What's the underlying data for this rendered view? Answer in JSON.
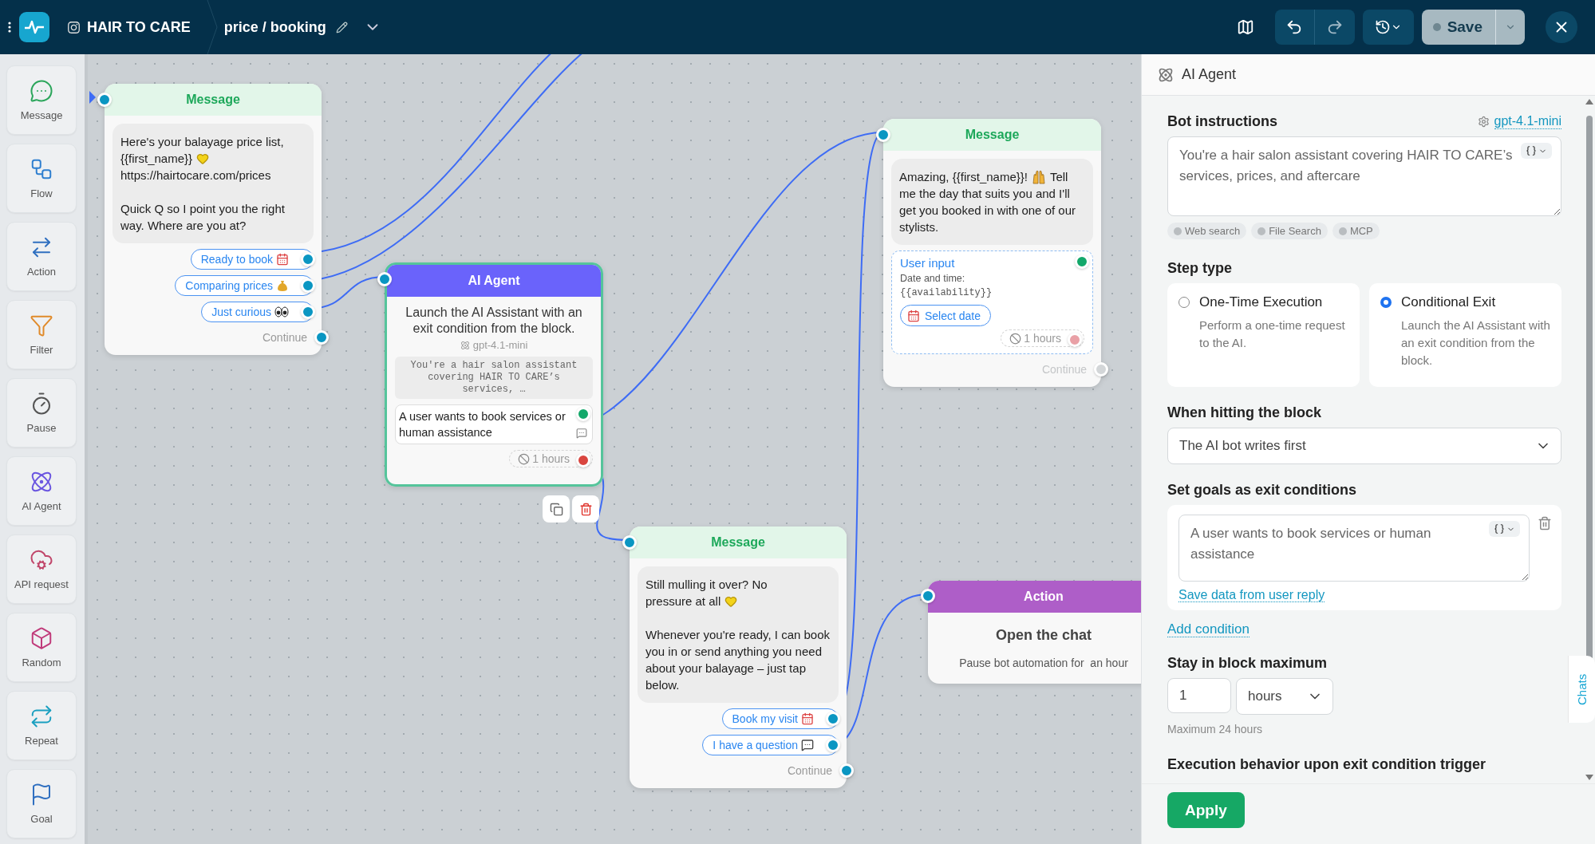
{
  "topbar": {
    "account": "HAIR TO CARE",
    "flow_name": "price / booking",
    "save": "Save"
  },
  "sidebar": {
    "items": [
      {
        "label": "Message",
        "kind": "message"
      },
      {
        "label": "Flow",
        "kind": "flow"
      },
      {
        "label": "Action",
        "kind": "action"
      },
      {
        "label": "Filter",
        "kind": "filter"
      },
      {
        "label": "Pause",
        "kind": "pause"
      },
      {
        "label": "AI Agent",
        "kind": "ai"
      },
      {
        "label": "API request",
        "kind": "api"
      },
      {
        "label": "Random",
        "kind": "random"
      },
      {
        "label": "Repeat",
        "kind": "repeat"
      },
      {
        "label": "Goal",
        "kind": "goal"
      }
    ]
  },
  "canvas": {
    "nodes": [
      {
        "kind": "message",
        "title": "Message",
        "paragraphs": [
          [
            [
              "Here's your balayage price list,"
            ],
            [
              "{{first_name}}"
            ],
            [
              "https://hairtocare.com/prices"
            ]
          ],
          [
            [
              "Quick Q so I point you the right way. Where are you at?"
            ]
          ]
        ],
        "buttons": [
          "Ready to book",
          "Comparing prices",
          "Just curious"
        ],
        "continue": {
          "label": "Continue",
          "disabled": false
        }
      },
      {
        "kind": "ai_agent",
        "title": "AI Agent",
        "selected": true,
        "description": "Launch the AI Assistant with an exit condition from the block.",
        "model": "gpt-4.1-mini",
        "prompt": "You're a hair salon assistant covering HAIR TO CARE’s services, …",
        "condition": "A user wants to book services or human assistance",
        "timeout": "1 hours"
      },
      {
        "kind": "message",
        "title": "Message",
        "paragraphs": [
          [
            [
              "Amazing, {{first_name}}!",
              "Tell"
            ],
            [
              "me the day that suits you and I'll get you booked in with one of our stylists."
            ]
          ]
        ],
        "user_input": {
          "title": "User input",
          "label": "Date and time:",
          "variable": "{{availability}}",
          "button": "Select date",
          "timeout": "1 hours"
        },
        "continue": {
          "label": "Continue",
          "disabled": true
        }
      },
      {
        "kind": "message",
        "title": "Message",
        "paragraphs": [
          [
            [
              "Still mulling it over? No"
            ],
            [
              "pressure at all"
            ]
          ],
          [
            [
              "Whenever you're ready, I can book you in or send anything you need about your balayage – just tap below."
            ]
          ]
        ],
        "buttons": [
          "Book my visit",
          "I have a question"
        ],
        "continue": {
          "label": "Continue",
          "disabled": false
        }
      },
      {
        "kind": "action",
        "title": "Action",
        "action": "Open the chat",
        "detail": "Pause bot automation for  an hour"
      }
    ]
  },
  "panel": {
    "title": "AI Agent",
    "bot_instructions": {
      "label": "Bot instructions",
      "model": "gpt-4.1-mini",
      "value": "You're a hair salon assistant covering HAIR TO CARE’s services, prices, and aftercare",
      "tools": [
        {
          "label": "Web search",
          "on": false
        },
        {
          "label": "File Search",
          "on": false
        },
        {
          "label": "MCP",
          "on": false
        }
      ]
    },
    "step_type": {
      "label": "Step type",
      "options": [
        {
          "title": "One-Time Execution",
          "description": "Perform a one-time request to the AI.",
          "selected": false
        },
        {
          "title": "Conditional Exit",
          "description": "Launch the AI Assistant with an exit condition from the block.",
          "selected": true
        }
      ]
    },
    "when_hitting": {
      "label": "When hitting the block",
      "value": "The AI bot writes first"
    },
    "goals": {
      "label": "Set goals as exit conditions",
      "conditions": [
        {
          "value": "A user wants to book services or human assistance",
          "link": "Save data from user reply"
        }
      ],
      "add": "Add condition"
    },
    "stay": {
      "label": "Stay in block maximum",
      "value": "1",
      "unit": "hours",
      "hint": "Maximum 24 hours"
    },
    "execution": {
      "label": "Execution behavior upon exit condition trigger"
    },
    "apply": "Apply",
    "chats_tab": "Chats"
  }
}
